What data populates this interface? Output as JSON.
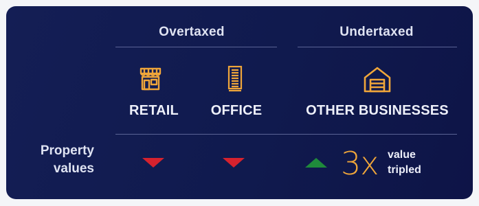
{
  "groups": {
    "overtaxed": "Overtaxed",
    "undertaxed": "Undertaxed"
  },
  "categories": [
    {
      "label": "RETAIL",
      "icon": "storefront-icon",
      "property_value_trend": "down"
    },
    {
      "label": "OFFICE",
      "icon": "office-building-icon",
      "property_value_trend": "down"
    },
    {
      "label": "OTHER BUSINESSES",
      "icon": "warehouse-garage-icon",
      "property_value_trend": "up",
      "multiplier": "3x",
      "note_line1": "value",
      "note_line2": "tripled"
    }
  ],
  "row": {
    "label_line1": "Property",
    "label_line2": "values"
  },
  "colors": {
    "background": "#101a4e",
    "accent_orange": "#f0a63a",
    "down_red": "#d6222e",
    "up_green": "#1f8a3b",
    "rule": "#5b6496"
  }
}
